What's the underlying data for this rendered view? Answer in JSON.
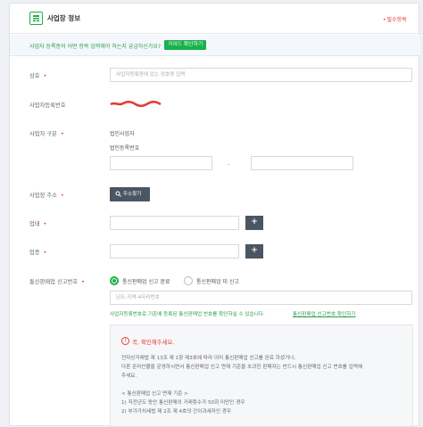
{
  "header": {
    "title": "사업장 정보",
    "required_label": "필수항목"
  },
  "guide": {
    "text": "사업자 등록증의 어떤 항목 입력해야 하는지 궁금하신가요?",
    "button_label": "가이드 확인하기"
  },
  "form": {
    "name": {
      "label": "상호",
      "placeholder": "사업자등록증에 있는 상호명 입력"
    },
    "biz_number": {
      "label": "사업자등록번호"
    },
    "biz_type": {
      "label": "사업자 구분",
      "value": "법인사업자",
      "corp_number_label": "법인등록번호",
      "separator": "-"
    },
    "address": {
      "label": "사업장 주소",
      "button_label": "주소찾기"
    },
    "industry": {
      "label": "업태",
      "add_label": "+"
    },
    "category": {
      "label": "업종",
      "add_label": "+"
    },
    "mail_order": {
      "label": "통신판매업 신고번호",
      "options": [
        "통신판매업 신고 완료",
        "통신판매업 미 신고"
      ],
      "selected": "통신판매업 신고 완료",
      "placeholder": "년도-지역-4자리번호",
      "info_text": "사업자등록번호로 기존에 등록된 통신판매업 번호를 확인하실 수 있습니다.",
      "info_link": "통신판매업 신고번호 확인하기"
    }
  },
  "notice": {
    "title": "꼭, 확인해주세요.",
    "lines": [
      "전자상거래법 제 13조 제 1항 제3호에 따라 이미 통신판매업 신고를 완료 하셨거나,",
      "다른 온라인몰을 운영하시면서 통신판매업 신고 면제 기준을 초과한 판매자는 반드시 통신판매업 신고 번호를 입력해",
      "주세요.",
      "",
      "< 통신판매업 신고 면제 기준 >",
      "1) 직전년도 동안 통신판매의 거래횟수가 50회 미만인 경우",
      "2) 부가가치세법 제 2조 제 4호의 간이과세자인 경우"
    ]
  },
  "colors": {
    "accent_green": "#19b145",
    "required_red": "#e53935",
    "dark_button": "#4a5662"
  }
}
